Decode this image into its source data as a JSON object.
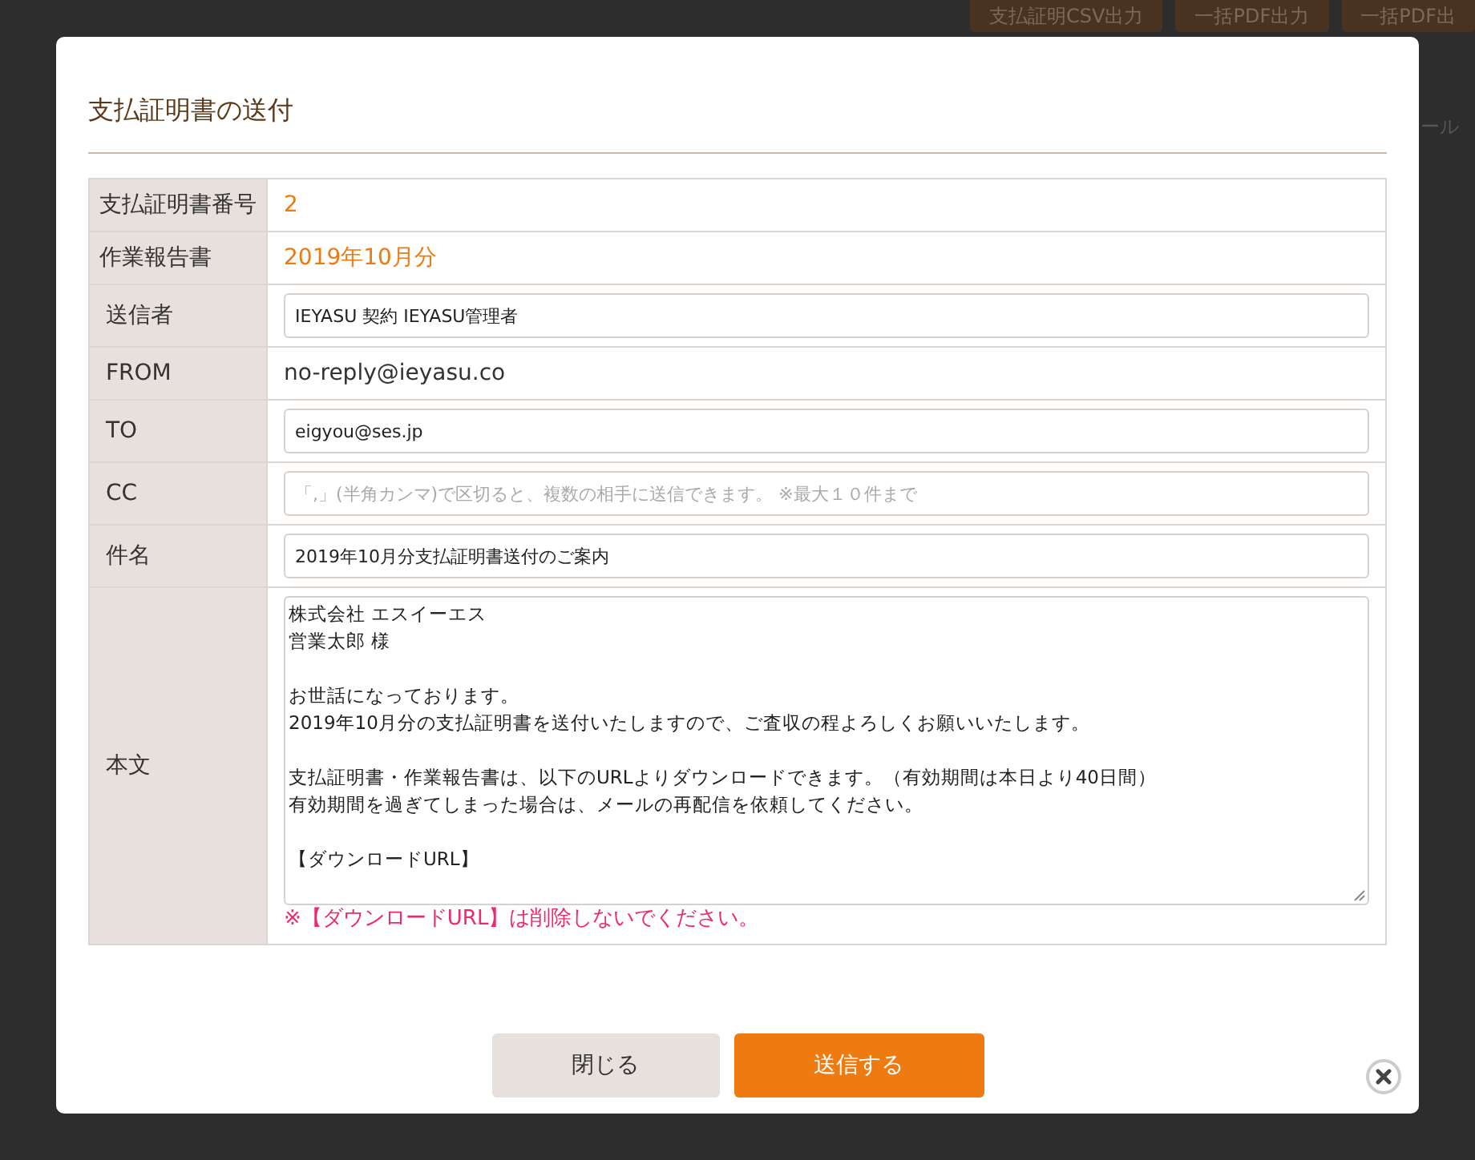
{
  "background": {
    "buttons": [
      "支払証明CSV出力",
      "一括PDF出力",
      "一括PDF出"
    ],
    "fragment": "ール"
  },
  "dialog": {
    "title": "支払証明書の送付",
    "rows": [
      {
        "label": "支払証明書番号",
        "kind": "highlight",
        "value": "2"
      },
      {
        "label": "作業報告書",
        "kind": "highlight",
        "value": "2019年10月分"
      },
      {
        "label": "送信者",
        "kind": "input",
        "value": "IEYASU 契約 IEYASU管理者"
      },
      {
        "label": "FROM",
        "kind": "text",
        "value": "no-reply@ieyasu.co"
      },
      {
        "label": "TO",
        "kind": "input",
        "value": "eigyou@ses.jp"
      },
      {
        "label": "CC",
        "kind": "input",
        "placeholder": "「,」(半角カンマ)で区切ると、複数の相手に送信できます。 ※最大１０件まで"
      },
      {
        "label": "件名",
        "kind": "input",
        "value": "2019年10月分支払証明書送付のご案内"
      },
      {
        "label": "本文",
        "kind": "textarea",
        "paragraphs": [
          [
            "株式会社 エスイーエス",
            "営業太郎 様"
          ],
          [
            "お世話になっております。",
            "2019年10月分の支払証明書を送付いたしますので、ご査収の程よろしくお願いいたします。"
          ],
          [
            "支払証明書・作業報告書は、以下のURLよりダウンロードできます。（有効期間は本日より40日間）",
            "有効期間を過ぎてしまった場合は、メールの再配信を依頼してください。"
          ],
          [
            "【ダウンロードURL】"
          ]
        ],
        "note": "※【ダウンロードURL】は削除しないでください。"
      }
    ],
    "buttons": [
      {
        "label": "閉じる",
        "kind": "secondary"
      },
      {
        "label": "送信する",
        "kind": "primary"
      }
    ]
  }
}
